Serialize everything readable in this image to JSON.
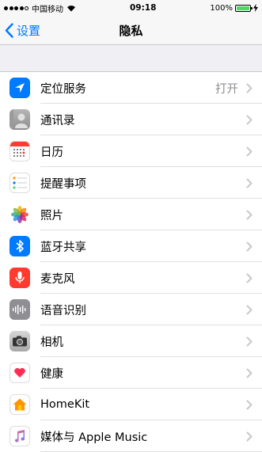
{
  "status_bar": {
    "carrier": "中国移动",
    "time": "09:18",
    "battery_percent": "100%",
    "battery_level": 1.0,
    "colors": {
      "battery": "#4cd964"
    }
  },
  "nav": {
    "back_label": "设置",
    "title": "隐私"
  },
  "colors": {
    "accent": "#007aff",
    "background": "#efeff4"
  },
  "items": [
    {
      "label": "定位服务",
      "value": "打开",
      "icon": "location-arrow-icon"
    },
    {
      "label": "通讯录",
      "value": "",
      "icon": "contacts-icon"
    },
    {
      "label": "日历",
      "value": "",
      "icon": "calendar-icon"
    },
    {
      "label": "提醒事项",
      "value": "",
      "icon": "reminders-icon"
    },
    {
      "label": "照片",
      "value": "",
      "icon": "photos-icon"
    },
    {
      "label": "蓝牙共享",
      "value": "",
      "icon": "bluetooth-icon"
    },
    {
      "label": "麦克风",
      "value": "",
      "icon": "microphone-icon"
    },
    {
      "label": "语音识别",
      "value": "",
      "icon": "speech-recognition-icon"
    },
    {
      "label": "相机",
      "value": "",
      "icon": "camera-icon"
    },
    {
      "label": "健康",
      "value": "",
      "icon": "health-icon"
    },
    {
      "label": "HomeKit",
      "value": "",
      "icon": "homekit-icon"
    },
    {
      "label": "媒体与 Apple Music",
      "value": "",
      "icon": "music-icon"
    }
  ]
}
